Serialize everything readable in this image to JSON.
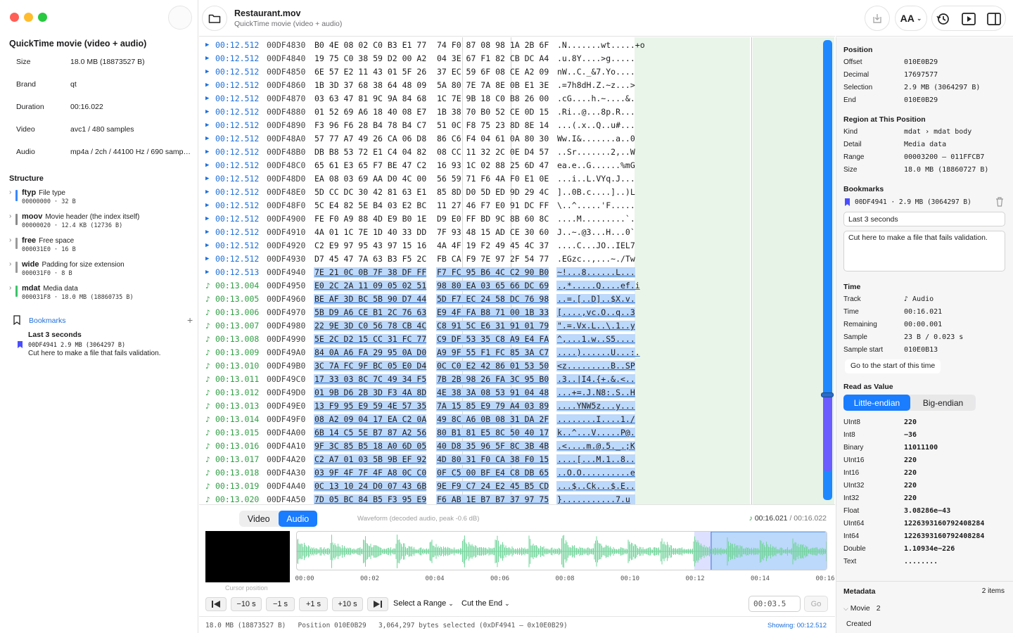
{
  "window": {
    "title": "Restaurant.mov",
    "subtitle": "QuickTime movie (video + audio)"
  },
  "colors": {
    "accent": "#1a7cff",
    "audio": "#2f9e44",
    "selection": "#bcd8fb",
    "waveform": "#72d59b"
  },
  "sidebar": {
    "title": "QuickTime movie (video + audio)",
    "info": [
      {
        "key": "Size",
        "value": "18.0 MB (18873527 B)"
      },
      {
        "key": "Brand",
        "value": "qt"
      },
      {
        "key": "Duration",
        "value": "00:16.022"
      },
      {
        "key": "Video",
        "value": "avc1 / 480 samples"
      },
      {
        "key": "Audio",
        "value": "mp4a / 2ch / 44100 Hz / 690 samples"
      }
    ],
    "structure_label": "Structure",
    "structure": [
      {
        "name": "ftyp",
        "desc": "File type",
        "meta": "00000000 · 32 B",
        "color": "#3a86ff"
      },
      {
        "name": "moov",
        "desc": "Movie header (the index itself)",
        "meta": "00000020 · 12.4 KB (12736 B)",
        "color": "#8a8a8a"
      },
      {
        "name": "free",
        "desc": "Free space",
        "meta": "000031E0 · 16 B",
        "color": "#9a9a9a"
      },
      {
        "name": "wide",
        "desc": "Padding for size extension",
        "meta": "000031F0 · 8 B",
        "color": "#9a9a9a"
      },
      {
        "name": "mdat",
        "desc": "Media data",
        "meta": "000031F8 · 18.0 MB (18860735 B)",
        "color": "#3cc46a"
      }
    ],
    "bookmarks_label": "Bookmarks",
    "bookmarks_add": "+",
    "bookmark": {
      "title": "Last 3 seconds",
      "meta": "00DF4941  2.9 MB (3064297 B)",
      "note": "Cut here to make a file that fails validation."
    }
  },
  "hex_rows": [
    {
      "kind": "video",
      "time": "00:12.512",
      "off": "00DF4830",
      "b1": "B0 4E 08 02 C0 B3 E1 77",
      "b2": "74 F0 87 08 98 1A 2B 6F",
      "asc": ".N.......wt.....+o",
      "sel": false
    },
    {
      "kind": "video",
      "time": "00:12.512",
      "off": "00DF4840",
      "b1": "19 75 C0 38 59 D2 00 A2",
      "b2": "04 3E 67 F1 82 CB DC A4",
      "asc": ".u.8Y....>g.....",
      "sel": false
    },
    {
      "kind": "video",
      "time": "00:12.512",
      "off": "00DF4850",
      "b1": "6E 57 E2 11 43 01 5F 26",
      "b2": "37 EC 59 6F 08 CE A2 09",
      "asc": "nW..C._&7.Yo....",
      "sel": false
    },
    {
      "kind": "video",
      "time": "00:12.512",
      "off": "00DF4860",
      "b1": "1B 3D 37 68 38 64 48 09",
      "b2": "5A 80 7E 7A 8E 0B E1 3E",
      "asc": ".=7h8dH.Z.~z...>",
      "sel": false
    },
    {
      "kind": "video",
      "time": "00:12.512",
      "off": "00DF4870",
      "b1": "03 63 47 81 9C 9A 84 68",
      "b2": "1C 7E 9B 18 C0 B8 26 00",
      "asc": ".cG....h.~....&.",
      "sel": false
    },
    {
      "kind": "video",
      "time": "00:12.512",
      "off": "00DF4880",
      "b1": "01 52 69 A6 18 40 08 E7",
      "b2": "1B 38 70 B0 52 CE 0D 15",
      "asc": ".Ri..@...8p.R...",
      "sel": false
    },
    {
      "kind": "video",
      "time": "00:12.512",
      "off": "00DF4890",
      "b1": "F3 96 F6 28 B4 78 B4 C7",
      "b2": "51 0C F8 75 23 8D 8E 14",
      "asc": "...(.x..Q..u#...",
      "sel": false
    },
    {
      "kind": "video",
      "time": "00:12.512",
      "off": "00DF48A0",
      "b1": "57 77 A7 49 26 CA 06 D8",
      "b2": "86 C6 F4 04 61 0A 80 30",
      "asc": "Ww.I&.......a..0",
      "sel": false
    },
    {
      "kind": "video",
      "time": "00:12.512",
      "off": "00DF48B0",
      "b1": "DB B8 53 72 E1 C4 04 82",
      "b2": "08 CC 11 32 2C 0E D4 57",
      "asc": "..Sr.......2,..W",
      "sel": false
    },
    {
      "kind": "video",
      "time": "00:12.512",
      "off": "00DF48C0",
      "b1": "65 61 E3 65 F7 BE 47 C2",
      "b2": "16 93 1C 02 88 25 6D 47",
      "asc": "ea.e..G......%mG",
      "sel": false
    },
    {
      "kind": "video",
      "time": "00:12.512",
      "off": "00DF48D0",
      "b1": "EA 08 03 69 AA D0 4C 00",
      "b2": "56 59 71 F6 4A F0 E1 0E",
      "asc": "...i..L.VYq.J...",
      "sel": false
    },
    {
      "kind": "video",
      "time": "00:12.512",
      "off": "00DF48E0",
      "b1": "5D CC DC 30 42 81 63 E1",
      "b2": "85 8D D0 5D ED 9D 29 4C",
      "asc": "]..0B.c....]..)L",
      "sel": false
    },
    {
      "kind": "video",
      "time": "00:12.512",
      "off": "00DF48F0",
      "b1": "5C E4 82 5E B4 03 E2 BC",
      "b2": "11 27 46 F7 E0 91 DC FF",
      "asc": "\\..^.....'F.....",
      "sel": false
    },
    {
      "kind": "video",
      "time": "00:12.512",
      "off": "00DF4900",
      "b1": "FE F0 A9 88 4D E9 B0 1E",
      "b2": "D9 E0 FF BD 9C 8B 60 8C",
      "asc": "....M.........`.",
      "sel": false
    },
    {
      "kind": "video",
      "time": "00:12.512",
      "off": "00DF4910",
      "b1": "4A 01 1C 7E 1D 40 33 DD",
      "b2": "7F 93 48 15 AD CE 30 60",
      "asc": "J..~.@3...H...0`",
      "sel": false
    },
    {
      "kind": "video",
      "time": "00:12.512",
      "off": "00DF4920",
      "b1": "C2 E9 97 95 43 97 15 16",
      "b2": "4A 4F 19 F2 49 45 4C 37",
      "asc": "....C...JO..IEL7",
      "sel": false
    },
    {
      "kind": "video",
      "time": "00:12.512",
      "off": "00DF4930",
      "b1": "D7 45 47 7A 63 B3 F5 2C",
      "b2": "FB CA F9 7E 97 2F 54 77",
      "asc": ".EGzc..,...~./Tw",
      "sel": false
    },
    {
      "kind": "video",
      "time": "00:12.513",
      "off": "00DF4940",
      "b1": "7E 21 0C 0B 7F 38 DF FF",
      "b2": "F7 FC 95 B6 4C C2 90 B0",
      "asc": "~!...8......L...",
      "sel": true
    },
    {
      "kind": "audio",
      "time": "00:13.004",
      "off": "00DF4950",
      "b1": "E0 2C 2A 11 09 05 02 51",
      "b2": "98 80 EA 03 65 66 DC 69",
      "asc": ".,*.....Q....ef.i",
      "sel": true
    },
    {
      "kind": "audio",
      "time": "00:13.005",
      "off": "00DF4960",
      "b1": "BE AF 3D BC 5B 90 D7 44",
      "b2": "5D F7 EC 24 58 DC 76 98",
      "asc": "..=.[..D]..$X.v.",
      "sel": true
    },
    {
      "kind": "audio",
      "time": "00:13.006",
      "off": "00DF4970",
      "b1": "5B D9 A6 CE B1 2C 76 63",
      "b2": "E9 4F FA B8 71 00 1B 33",
      "asc": "[....,vc.O..q..3",
      "sel": true
    },
    {
      "kind": "audio",
      "time": "00:13.007",
      "off": "00DF4980",
      "b1": "22 9E 3D C0 56 78 CB 4C",
      "b2": "C8 91 5C E6 31 91 01 79",
      "asc": "\".=.Vx.L..\\.1..y",
      "sel": true
    },
    {
      "kind": "audio",
      "time": "00:13.008",
      "off": "00DF4990",
      "b1": "5E 2C D2 15 CC 31 FC 77",
      "b2": "C9 DF 53 35 C8 A9 E4 FA",
      "asc": "^,...1.w..S5....",
      "sel": true
    },
    {
      "kind": "audio",
      "time": "00:13.009",
      "off": "00DF49A0",
      "b1": "84 0A A6 FA 29 95 0A D0",
      "b2": "A9 9F 55 F1 FC 85 3A C7",
      "asc": "....)......U...:.",
      "sel": true
    },
    {
      "kind": "audio",
      "time": "00:13.010",
      "off": "00DF49B0",
      "b1": "3C 7A FC 9F BC 05 E0 D4",
      "b2": "0C C0 E2 42 86 01 53 50",
      "asc": "<z.........B..SP",
      "sel": true
    },
    {
      "kind": "audio",
      "time": "00:13.011",
      "off": "00DF49C0",
      "b1": "17 33 03 8C 7C 49 34 F5",
      "b2": "7B 2B 98 26 FA 3C 95 B0",
      "asc": ".3..|I4.{+.&.<..",
      "sel": true
    },
    {
      "kind": "audio",
      "time": "00:13.012",
      "off": "00DF49D0",
      "b1": "01 9B D6 2B 3D F3 4A 8D",
      "b2": "4E 38 3A 08 53 91 04 48",
      "asc": "...+=.J.N8:.S..H",
      "sel": true
    },
    {
      "kind": "audio",
      "time": "00:13.013",
      "off": "00DF49E0",
      "b1": "13 F9 95 E9 59 4E 57 35",
      "b2": "7A 15 85 E9 79 A4 03 89",
      "asc": "....YNW5z...y...",
      "sel": true
    },
    {
      "kind": "audio",
      "time": "00:13.014",
      "off": "00DF49F0",
      "b1": "08 A2 09 04 17 EA C2 0A",
      "b2": "49 8C A6 0B 08 31 DA 2F",
      "asc": "........I....1./",
      "sel": true
    },
    {
      "kind": "audio",
      "time": "00:13.015",
      "off": "00DF4A00",
      "b1": "6B 14 C5 5E B7 87 A2 56",
      "b2": "80 B1 81 E5 8C 50 40 17",
      "asc": "k..^...V.....P@.",
      "sel": true
    },
    {
      "kind": "audio",
      "time": "00:13.016",
      "off": "00DF4A10",
      "b1": "9F 3C 85 B5 18 A0 6D 05",
      "b2": "40 D8 35 96 5F 8C 3B 4B",
      "asc": ".<....m.@.5._.;K",
      "sel": true
    },
    {
      "kind": "audio",
      "time": "00:13.017",
      "off": "00DF4A20",
      "b1": "C2 A7 01 03 5B 9B EF 92",
      "b2": "4D 80 31 F0 CA 38 F0 15",
      "asc": "....[...M.1..8..",
      "sel": true
    },
    {
      "kind": "audio",
      "time": "00:13.018",
      "off": "00DF4A30",
      "b1": "03 9F 4F 7F 4F A8 0C C0",
      "b2": "0F C5 00 BF E4 C8 DB 65",
      "asc": "..O.O..........e",
      "sel": true
    },
    {
      "kind": "audio",
      "time": "00:13.019",
      "off": "00DF4A40",
      "b1": "0C 13 10 24 D0 07 43 6B",
      "b2": "9E F9 C7 24 E2 45 B5 CD",
      "asc": "...$..Ck...$.E..",
      "sel": true
    },
    {
      "kind": "audio",
      "time": "00:13.020",
      "off": "00DF4A50",
      "b1": "7D 05 BC 84 B5 F3 95 E9",
      "b2": "F6 AB 1E B7 B7 37 97 75",
      "asc": "}...........7.u",
      "sel": true
    }
  ],
  "bottom": {
    "tabs": [
      "Video",
      "Audio"
    ],
    "active_tab": "Audio",
    "waveform_caption": "Waveform (decoded audio, peak -0.6 dB)",
    "current_time": "00:16.021",
    "total_time": "/ 00:16.022",
    "cursor_label": "Cursor position",
    "ticks": [
      "00:00",
      "00:02",
      "00:04",
      "00:06",
      "00:08",
      "00:10",
      "00:12",
      "00:14",
      "00:16"
    ],
    "selection_start_fraction": 0.78,
    "buttons": [
      "−10 s",
      "−1 s",
      "+1 s",
      "+10 s"
    ],
    "select_range": "Select a Range",
    "cut_end": "Cut the End",
    "go_placeholder": "00:03.5",
    "go": "Go",
    "status_left": "18.0 MB (18873527 B)   Position 010E0B29   3,064,297 bytes selected (0xDF4941 — 0x10E0B29)",
    "status_right": "Showing: 00:12.512"
  },
  "toolbar": {
    "text_size": "AA"
  },
  "inspector": {
    "position": {
      "title": "Position",
      "rows": [
        {
          "k": "Offset",
          "v": "010E0B29"
        },
        {
          "k": "Decimal",
          "v": "17697577"
        },
        {
          "k": "Selection",
          "v": "2.9 MB (3064297 B)"
        },
        {
          "k": "End",
          "v": "010E0B29"
        }
      ]
    },
    "region": {
      "title": "Region at This Position",
      "rows": [
        {
          "k": "Kind",
          "v": "mdat › mdat body"
        },
        {
          "k": "Detail",
          "v": "Media data"
        },
        {
          "k": "Range",
          "v": "00003200 — 011FFCB7"
        },
        {
          "k": "Size",
          "v": "18.0 MB (18860727 B)"
        }
      ]
    },
    "bookmarks": {
      "title": "Bookmarks",
      "line": "00DF4941 · 2.9 MB (3064297 B)",
      "name": "Last 3 seconds",
      "note": "Cut here to make a file that fails validation."
    },
    "time": {
      "title": "Time",
      "rows": [
        {
          "k": "Track",
          "v": "♪ Audio"
        },
        {
          "k": "Time",
          "v": "00:16.021"
        },
        {
          "k": "Remaining",
          "v": "00:00.001"
        },
        {
          "k": "Sample",
          "v": "23 B / 0.023 s"
        },
        {
          "k": "Sample start",
          "v": "010E0B13"
        }
      ],
      "go_start": "Go to the start of this time"
    },
    "value": {
      "title": "Read as Value",
      "endian": [
        "Little-endian",
        "Big-endian"
      ],
      "rows": [
        {
          "k": "UInt8",
          "v": "220"
        },
        {
          "k": "Int8",
          "v": "−36"
        },
        {
          "k": "Binary",
          "v": "11011100"
        },
        {
          "k": "UInt16",
          "v": "220"
        },
        {
          "k": "Int16",
          "v": "220"
        },
        {
          "k": "UInt32",
          "v": "220"
        },
        {
          "k": "Int32",
          "v": "220"
        },
        {
          "k": "Float",
          "v": "3.08286e−43"
        },
        {
          "k": "UInt64",
          "v": "1226393160792408284"
        },
        {
          "k": "Int64",
          "v": "1226393160792408284"
        },
        {
          "k": "Double",
          "v": "1.10934e−226"
        },
        {
          "k": "Text",
          "v": "........"
        }
      ]
    },
    "metadata": {
      "title": "Metadata",
      "count": "2 items",
      "movie": "Movie",
      "movie_count": "2",
      "created": "Created"
    }
  }
}
